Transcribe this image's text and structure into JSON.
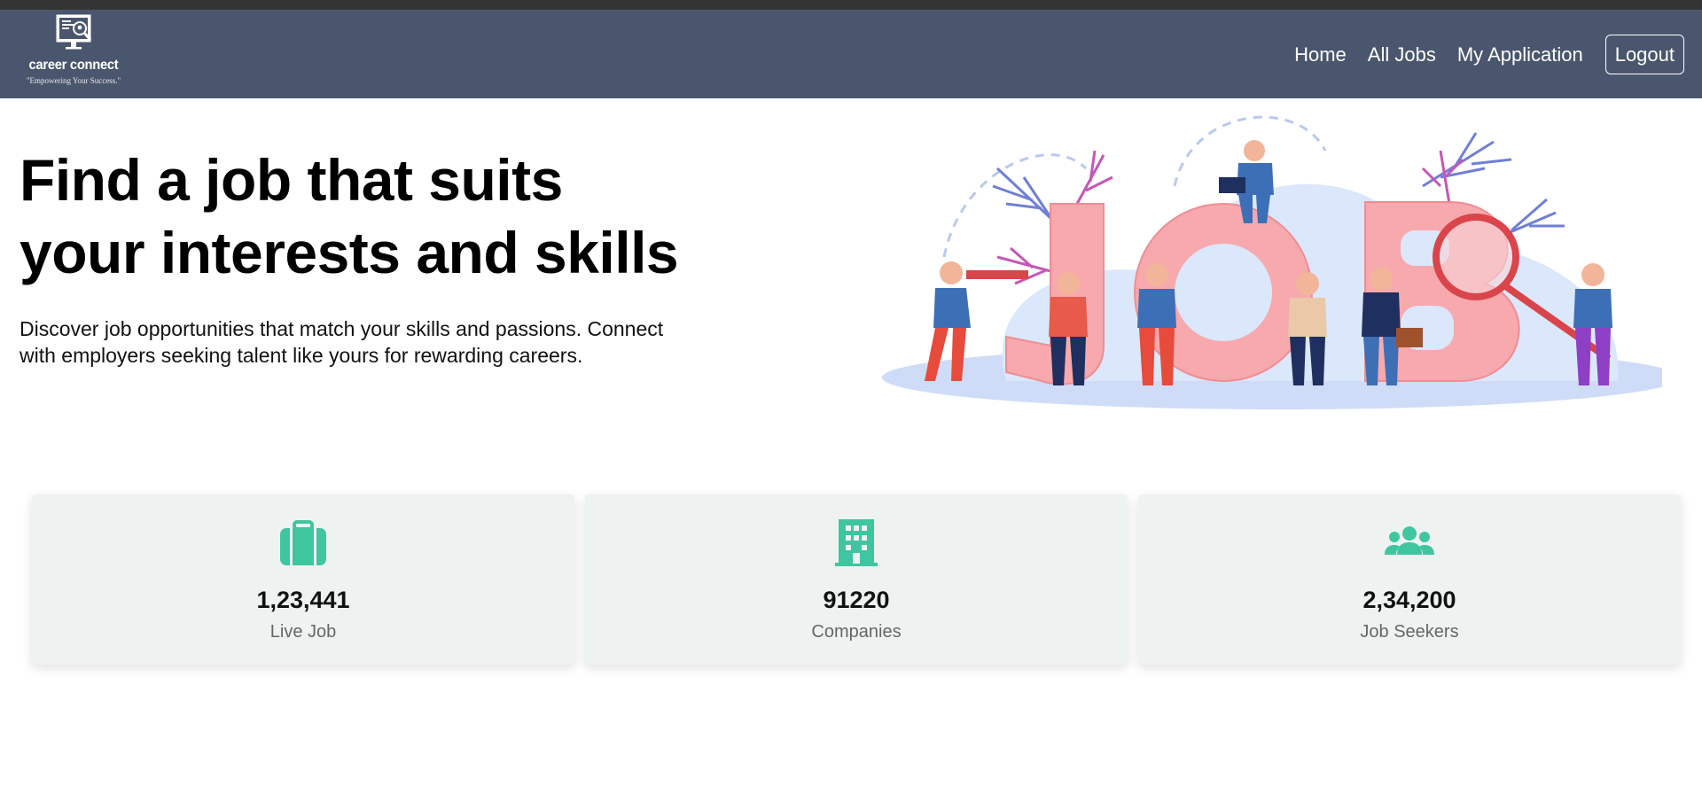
{
  "brand": {
    "name": "career connect",
    "tagline": "\"Empowering Your Success.\""
  },
  "nav": {
    "home": "Home",
    "all_jobs": "All Jobs",
    "my_application": "My Application",
    "logout": "Logout"
  },
  "hero": {
    "title_line1": "Find a job that suits",
    "title_line2": "your interests and skills",
    "description": "Discover job opportunities that match your skills and passions. Connect with employers seeking talent like yours for rewarding careers.",
    "illustration_text": "JOB"
  },
  "stats": [
    {
      "icon": "briefcase-icon",
      "value": "1,23,441",
      "label": "Live Job"
    },
    {
      "icon": "building-icon",
      "value": "91220",
      "label": "Companies"
    },
    {
      "icon": "users-icon",
      "value": "2,34,200",
      "label": "Job Seekers"
    }
  ],
  "colors": {
    "navbar": "#4a566d",
    "accent": "#3fc6a0",
    "card": "#eef3f2",
    "job_letters": "#f7a9ad"
  }
}
